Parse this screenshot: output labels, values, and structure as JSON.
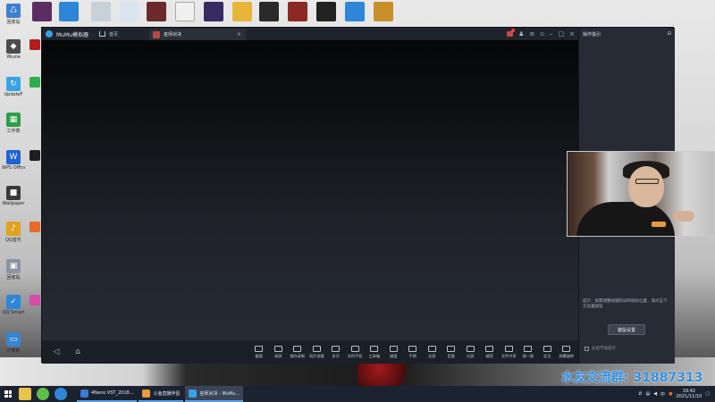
{
  "emulator": {
    "app_title": "MuMu模拟器",
    "home_tab": "首页",
    "game_tab": "巫师对决",
    "panel_title": "操作指引",
    "panel_hint": "提示：如需调整按键布局和指标位置，请点击下方设置按钮",
    "key_setting_button": "键鼠设置",
    "no_remind": "此后不再提示",
    "toolbar": [
      {
        "label": "截图",
        "icon": "camera-icon"
      },
      {
        "label": "录屏",
        "icon": "record-icon"
      },
      {
        "label": "操作录制",
        "icon": "macro-icon"
      },
      {
        "label": "同步滤镜",
        "icon": "pointer-icon"
      },
      {
        "label": "多开",
        "icon": "multi-icon"
      },
      {
        "label": "实时手机",
        "icon": "phone-icon"
      },
      {
        "label": "工具箱",
        "icon": "toolbox-icon"
      },
      {
        "label": "键盘",
        "icon": "keyboard-icon"
      },
      {
        "label": "手柄",
        "icon": "gamepad-icon"
      },
      {
        "label": "全屏",
        "icon": "fullscreen-icon"
      },
      {
        "label": "音量",
        "icon": "volume-icon"
      },
      {
        "label": "分屏",
        "icon": "split-icon"
      },
      {
        "label": "裁剪",
        "icon": "crop-icon"
      },
      {
        "label": "文件共享",
        "icon": "folder-icon"
      },
      {
        "label": "摇一摇",
        "icon": "shake-icon"
      },
      {
        "label": "定位",
        "icon": "location-icon"
      },
      {
        "label": "屏幕旋转",
        "icon": "rotate-icon"
      }
    ]
  },
  "desktop_icons": [
    {
      "label": "回收站",
      "color": "#3f7fd1"
    },
    {
      "label": "Wuxia",
      "color": "#4c4c4c"
    },
    {
      "label": "UpdateF",
      "color": "#3aa3e6"
    },
    {
      "label": "工作表",
      "color": "#2e9e4a"
    },
    {
      "label": "WPS Office",
      "color": "#1f63d6"
    },
    {
      "label": "Wallpaper",
      "color": "#3a3a3a"
    },
    {
      "label": "QQ音乐",
      "color": "#e0a21f"
    },
    {
      "label": "回收站",
      "color": "#8a95a3"
    },
    {
      "label": "QQ Smart",
      "color": "#2f86d8"
    },
    {
      "label": "计算机",
      "color": "#3784d1"
    }
  ],
  "overlay": {
    "qq_group": "水友交流群: 31887313"
  },
  "taskbar": {
    "tasks": [
      {
        "label": "4Nano VST_2018...",
        "color": "#3a7bd5"
      },
      {
        "label": "斗鱼直播伴侣",
        "color": "#e89a3c"
      },
      {
        "label": "巫师对决 - MuMu...",
        "color": "#34a3e6"
      }
    ],
    "time": "19:42",
    "date": "2021/11/10"
  }
}
